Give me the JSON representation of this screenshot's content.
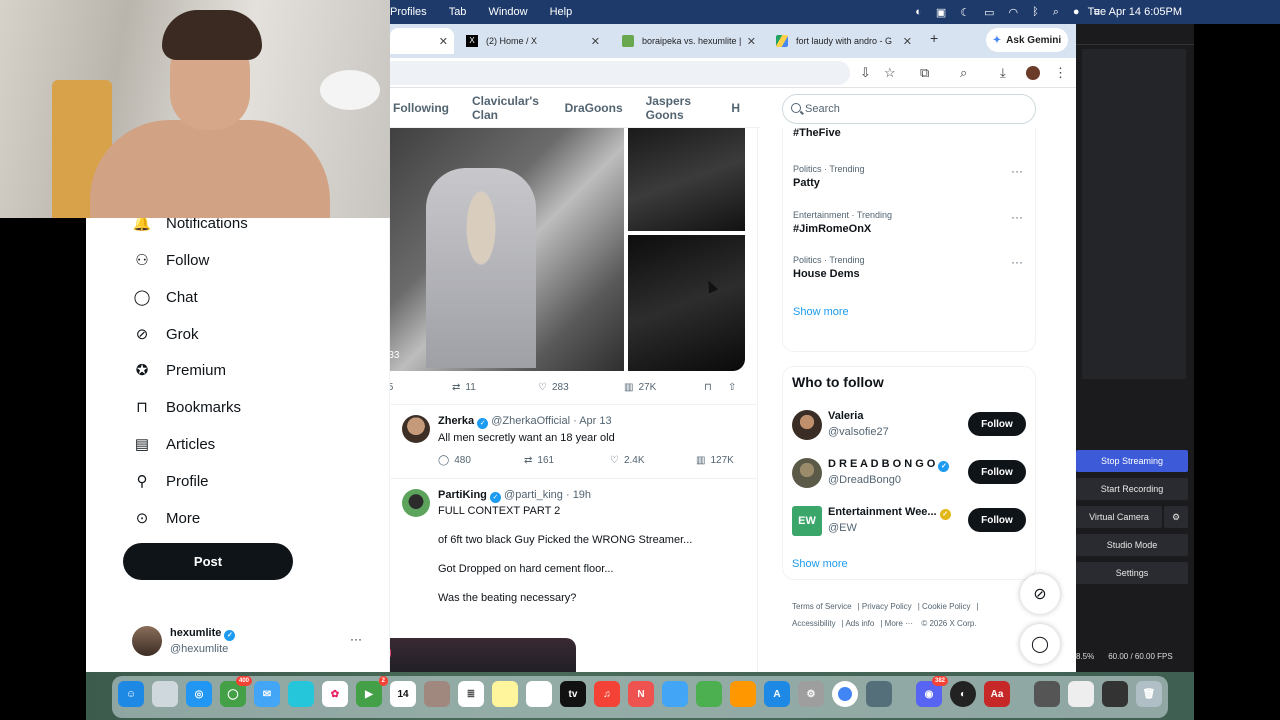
{
  "menubar": {
    "menus": [
      "Profiles",
      "Tab",
      "Window",
      "Help"
    ],
    "clock": "Tue Apr 14  6:05PM"
  },
  "browser": {
    "tabs": [
      {
        "label": "(2) Home / X",
        "icon": "x-logo-icon"
      },
      {
        "label": "boraipeka vs. hexumlite |",
        "icon": "flask-icon"
      },
      {
        "label": "fort laudy with andro - G",
        "icon": "drive-icon"
      }
    ],
    "ask_gemini": "Ask Gemini"
  },
  "x": {
    "home_tabs": [
      "Following",
      "Clavicular's Clan",
      "DraGoons",
      "Jaspers Goons",
      "H"
    ],
    "video_duration": "0:33",
    "tweet0_stats": {
      "replies": "45",
      "reposts": "11",
      "likes": "283",
      "views": "27K"
    },
    "tweets": [
      {
        "name": "Zherka",
        "handle": "@ZherkaOfficial",
        "date": "· Apr 13",
        "text": "All men secretly want an 18 year old",
        "replies": "480",
        "reposts": "161",
        "likes": "2.4K",
        "views": "127K"
      },
      {
        "name": "PartiKing",
        "handle": "@parti_king",
        "date": "· 19h",
        "lines": [
          "FULL CONTEXT PART 2",
          "of 6ft two black Guy Picked the WRONG Streamer...",
          "Got Dropped on hard cement floor...",
          "Was the beating necessary?"
        ]
      }
    ],
    "search_placeholder": "Search",
    "trends": [
      {
        "category": "",
        "name": "#TheFive"
      },
      {
        "category": "Politics · Trending",
        "name": "Patty"
      },
      {
        "category": "Entertainment · Trending",
        "name": "#JimRomeOnX"
      },
      {
        "category": "Politics · Trending",
        "name": "House Dems"
      }
    ],
    "show_more": "Show more",
    "who_to_follow_title": "Who to follow",
    "who_to_follow": [
      {
        "name": "Valeria",
        "handle": "@valsofie27",
        "button": "Follow"
      },
      {
        "name": "D R E A D  B O N G O",
        "handle": "@DreadBong0",
        "button": "Follow"
      },
      {
        "name": "Entertainment Wee...",
        "handle": "@EW",
        "button": "Follow",
        "avatar_text": "EW"
      }
    ],
    "show_more_2": "Show more",
    "footer": [
      "Terms of Service",
      "Privacy Policy",
      "Cookie Policy",
      "Accessibility",
      "Ads info",
      "More ···",
      "© 2026 X Corp."
    ],
    "nav": [
      {
        "label": "Notifications",
        "icon": "bell-icon"
      },
      {
        "label": "Follow",
        "icon": "person-plus-icon"
      },
      {
        "label": "Chat",
        "icon": "chat-bubble-icon"
      },
      {
        "label": "Grok",
        "icon": "grok-icon"
      },
      {
        "label": "Premium",
        "icon": "verified-badge-icon"
      },
      {
        "label": "Bookmarks",
        "icon": "bookmark-icon"
      },
      {
        "label": "Articles",
        "icon": "article-icon"
      },
      {
        "label": "Profile",
        "icon": "person-icon"
      },
      {
        "label": "More",
        "icon": "more-circle-icon"
      }
    ],
    "post_button": "Post",
    "account": {
      "name": "hexumlite",
      "handle": "@hexumlite"
    }
  },
  "obs": {
    "buttons": [
      "Stop Streaming",
      "Start Recording",
      "Virtual Camera",
      "Studio Mode",
      "Settings"
    ],
    "cpu": "8.5%",
    "fps": "60.00 / 60.00 FPS"
  },
  "dock": {
    "calendar_day": "14",
    "messages_badge": "400",
    "facetime_badge": "2",
    "discord_badge": "382"
  }
}
